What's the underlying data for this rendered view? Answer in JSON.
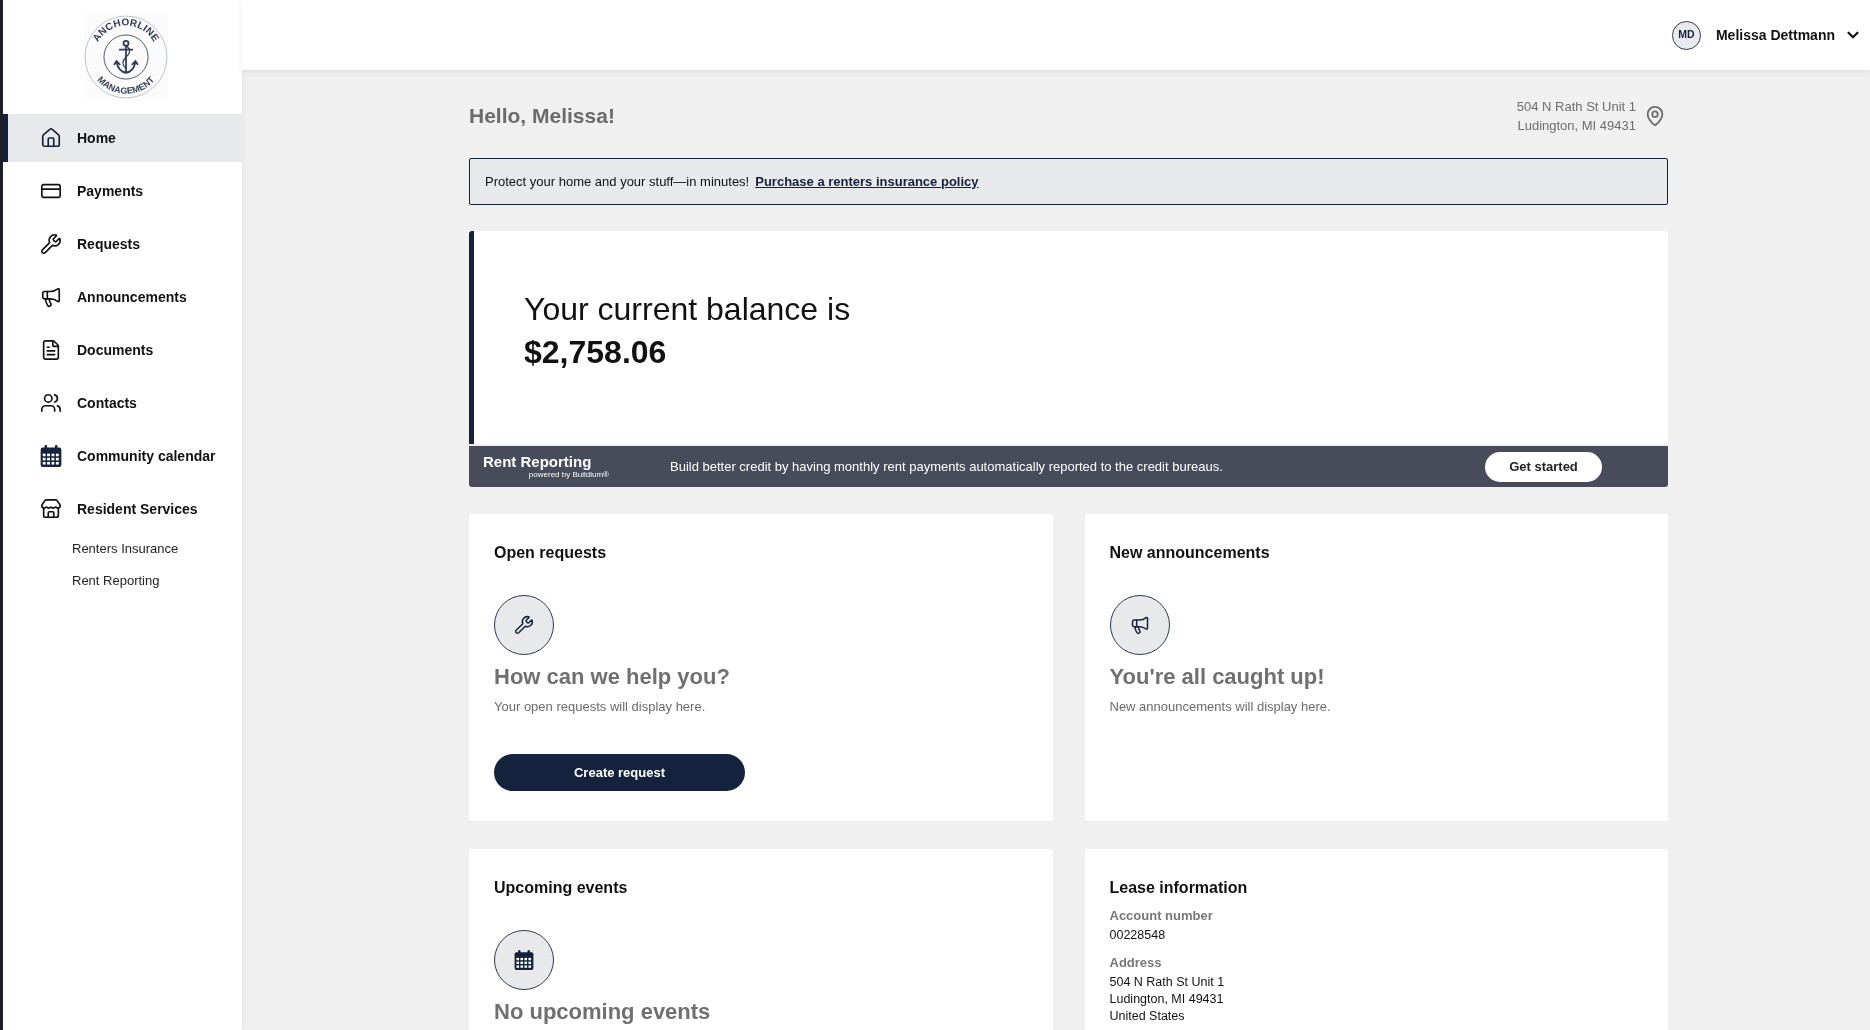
{
  "sidebar": {
    "logo": {
      "top_text": "ANCHORLINE",
      "bottom_text": "MANAGEMENT"
    },
    "items": [
      {
        "label": "Home",
        "selected": true
      },
      {
        "label": "Payments",
        "selected": false
      },
      {
        "label": "Requests",
        "selected": false
      },
      {
        "label": "Announcements",
        "selected": false
      },
      {
        "label": "Documents",
        "selected": false
      },
      {
        "label": "Contacts",
        "selected": false
      },
      {
        "label": "Community calendar",
        "selected": false
      },
      {
        "label": "Resident Services",
        "selected": false,
        "children": [
          {
            "label": "Renters Insurance",
            "selected": false
          },
          {
            "label": "Rent Reporting",
            "selected": false
          }
        ]
      }
    ]
  },
  "header": {
    "user": {
      "initials": "MD",
      "name": "Melissa Dettmann"
    }
  },
  "greeting": "Hello, Melissa!",
  "address": [
    "504 N Rath St Unit 1",
    "Ludington, MI 49431"
  ],
  "insurance_banner": {
    "text": "Protect your home and your stuff—in minutes!",
    "link": "Purchase a renters insurance policy"
  },
  "balance": {
    "label": "Your current balance is",
    "amount": "$2,758.06"
  },
  "rent_reporting": {
    "title": "Rent Reporting",
    "powered_by": "powered by Buildium®",
    "text": "Build better credit by having monthly rent payments automatically reported to the credit bureaus.",
    "button": "Get started"
  },
  "cards": [
    {
      "kind": "empty",
      "title": "Open requests",
      "heading": "How can we help you?",
      "text": "Your open requests will display here.",
      "button": "Create request"
    },
    {
      "kind": "empty",
      "title": "New announcements",
      "heading": "You're all caught up!",
      "text": "New announcements will display here."
    },
    {
      "kind": "empty",
      "title": "Upcoming events",
      "heading": "No upcoming events"
    },
    {
      "kind": "details",
      "title": "Lease information",
      "fields": [
        {
          "label": "Account number",
          "lines": [
            "00228548"
          ]
        },
        {
          "label": "Address",
          "lines": [
            "504 N Rath St Unit 1",
            "Ludington, MI 49431",
            "United States"
          ]
        }
      ]
    }
  ]
}
